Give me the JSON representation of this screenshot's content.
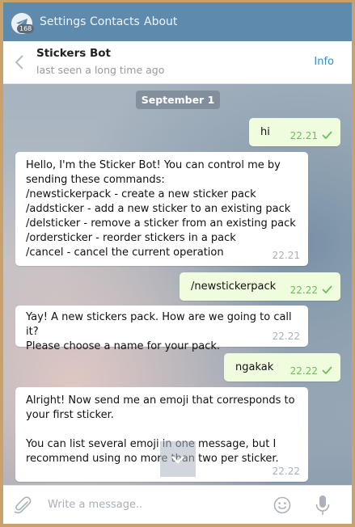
{
  "topbar": {
    "badge": "168",
    "menu": [
      "Settings",
      "Contacts",
      "About"
    ]
  },
  "header": {
    "title": "Stickers Bot",
    "status": "last seen a long time ago",
    "info": "Info"
  },
  "chat": {
    "date": "September 1",
    "messages": [
      {
        "dir": "out",
        "text": "hi",
        "time": "22.21",
        "read": true
      },
      {
        "dir": "in",
        "text": "Hello, I'm the Sticker Bot! You can control me by\nsending these commands:\n/newstickerpack - create a new sticker pack\n/addsticker - add a new sticker to an existing pack\n/delsticker - remove a sticker from an existing pack\n/ordersticker - reorder stickers in a pack\n/cancel - cancel the current operation",
        "time": "22.21"
      },
      {
        "dir": "out",
        "text": "/newstickerpack",
        "time": "22.22",
        "read": true
      },
      {
        "dir": "in",
        "text": "Yay! A new stickers pack. How are we going to call it?\nPlease choose a name for your pack.",
        "time": "22.22"
      },
      {
        "dir": "out",
        "text": "ngakak",
        "time": "22.22",
        "read": true
      },
      {
        "dir": "in",
        "text": "Alright! Now send me an emoji that corresponds to\nyour first sticker.\n\nYou can list several emoji in one message, but I\nrecommend using no more than two per sticker.",
        "time": "22.22"
      }
    ]
  },
  "composer": {
    "placeholder": "Write a message.."
  },
  "icons": {
    "app": "telegram-icon",
    "back": "chevron-left-icon",
    "attach": "paperclip-icon",
    "emoji": "smiley-icon",
    "mic": "microphone-icon",
    "scroll": "chevron-down-icon",
    "read": "check-icon"
  },
  "colors": {
    "topbar": "#5e8aad",
    "link": "#2e8fcf",
    "outgoing_bubble": "#effdde",
    "outgoing_meta": "#6cbf5c"
  }
}
